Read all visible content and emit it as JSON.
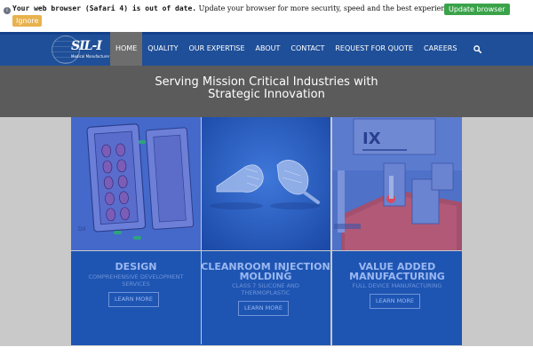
{
  "browser_warning": {
    "bold_text": "Your web browser (Safari 4) is out of date.",
    "rest_text": " Update your browser for more security, speed and the best experience on this site.",
    "update_label": "Update browser",
    "ignore_label": "Ignore"
  },
  "logo": {
    "mark": "SIL-I",
    "tagline": "Medical Manufacturer"
  },
  "nav": {
    "items": [
      "HOME",
      "QUALITY",
      "OUR EXPERTISE",
      "ABOUT",
      "CONTACT",
      "REQUEST FOR QUOTE",
      "CAREERS"
    ],
    "active_index": 0,
    "search_icon": "search-icon"
  },
  "hero": {
    "title": "Serving Mission Critical Industries with Strategic Innovation"
  },
  "services": [
    {
      "title": "DESIGN",
      "subtitle": "COMPREHENSIVE DEVELOPMENT SERVICES",
      "button": "LEARN MORE"
    },
    {
      "title": "CLEANROOM INJECTION MOLDING",
      "subtitle": "CLASS 7 SILICONE AND THERMOPLASTIC",
      "button": "LEARN MORE"
    },
    {
      "title": "VALUE ADDED MANUFACTURING",
      "subtitle": "FULL DEVICE MANUFACTURING",
      "button": "LEARN MORE"
    }
  ],
  "colors": {
    "nav_bg": "#1f4f98",
    "hero_bg": "#5b5b5b",
    "panel_bg": "#1e55b3",
    "update_green": "#3aa34a",
    "ignore_orange": "#e8b24e"
  }
}
